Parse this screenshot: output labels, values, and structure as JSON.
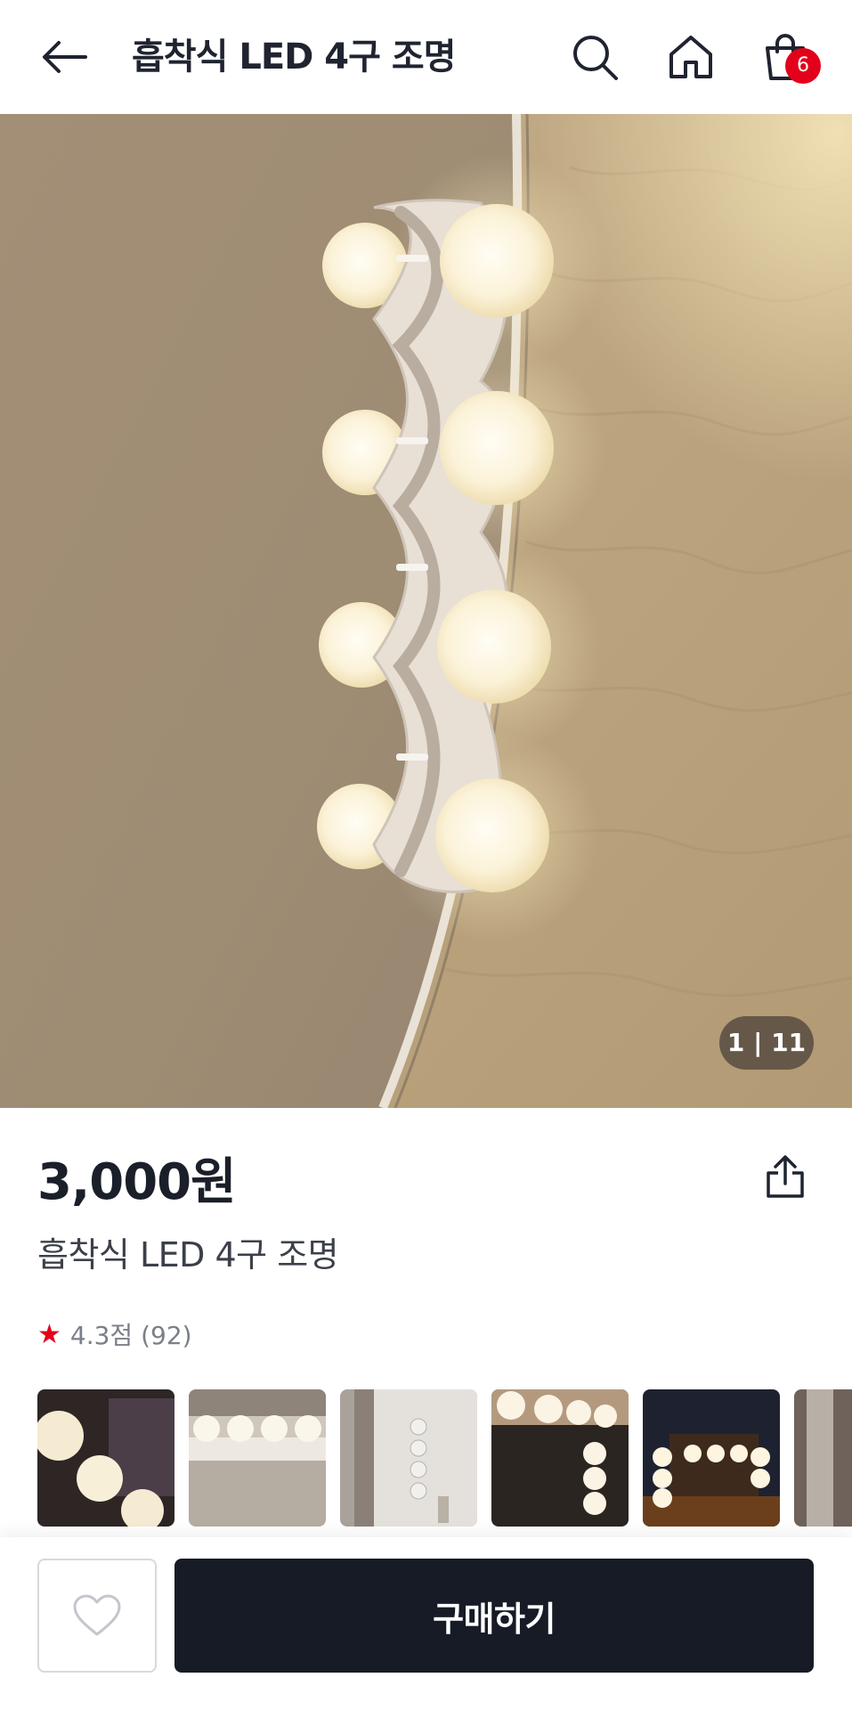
{
  "header": {
    "title": "흡착식 LED 4구 조명",
    "cart_count": "6",
    "icons": {
      "back": "arrow-left-icon",
      "search": "search-icon",
      "home": "home-icon",
      "cart": "shopping-bag-icon"
    }
  },
  "gallery": {
    "page_indicator": "1 | 11",
    "current_page": 1,
    "total_pages": 11
  },
  "product": {
    "price": "3,000원",
    "name": "흡착식 LED 4구 조명",
    "rating_text": "4.3점 (92)",
    "rating_value": 4.3,
    "review_count": 92
  },
  "thumbnails": [
    {
      "alt": "thumb-1"
    },
    {
      "alt": "thumb-2"
    },
    {
      "alt": "thumb-3"
    },
    {
      "alt": "thumb-4"
    },
    {
      "alt": "thumb-5"
    },
    {
      "alt": "thumb-6"
    }
  ],
  "bottom_bar": {
    "buy_label": "구매하기",
    "wish_icon": "heart-icon",
    "buy_color": "#161b26"
  },
  "colors": {
    "accent": "#e3001b",
    "text_primary": "#1b1f2a",
    "text_muted": "#7b7f88"
  }
}
